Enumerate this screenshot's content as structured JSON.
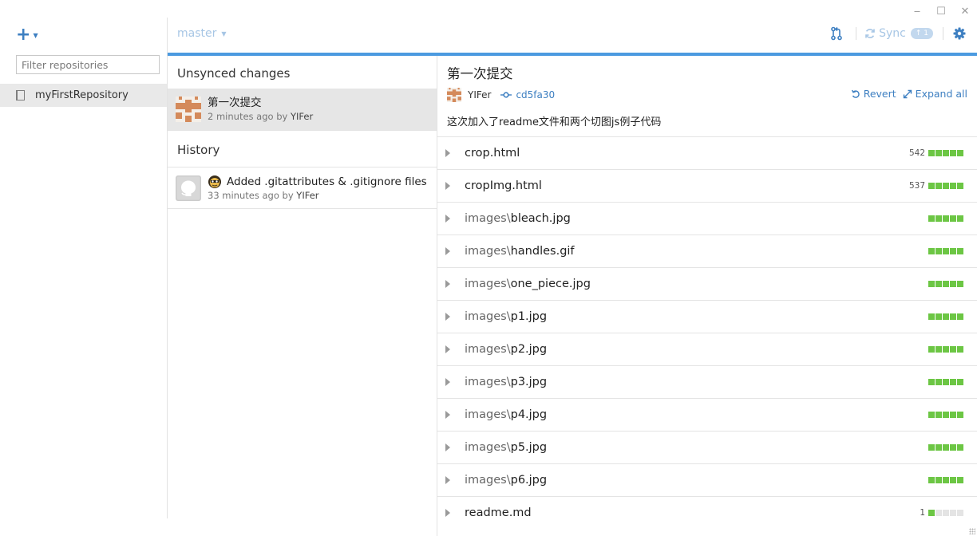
{
  "window": {
    "minimize_glyph": "‒",
    "maximize_glyph": "☐",
    "close_glyph": "✕"
  },
  "sidebar": {
    "add_glyph": "+",
    "filter_placeholder": "Filter repositories",
    "repos": [
      {
        "label": "myFirstRepository",
        "icon": "book-icon"
      }
    ]
  },
  "toolbar": {
    "branch": "master",
    "sync_label": "Sync",
    "sync_badge": "↑ 1"
  },
  "middle": {
    "unsynced_title": "Unsynced changes",
    "unsynced": [
      {
        "message": "第一次提交",
        "time": "2 minutes ago by",
        "author": "YIFer"
      }
    ],
    "history_title": "History",
    "history": [
      {
        "message": "Added .gitattributes & .gitignore files",
        "time": "33 minutes ago by",
        "author": "YIFer"
      }
    ]
  },
  "commit": {
    "title": "第一次提交",
    "author": "YIFer",
    "sha": "cd5fa30",
    "revert_label": "Revert",
    "expand_label": "Expand all",
    "description": "这次加入了readme文件和两个切图js例子代码"
  },
  "files": [
    {
      "dir": "",
      "name": "crop.html",
      "count": "542",
      "added_blocks": 5
    },
    {
      "dir": "",
      "name": "cropImg.html",
      "count": "537",
      "added_blocks": 5
    },
    {
      "dir": "images\\",
      "name": "bleach.jpg",
      "count": "",
      "added_blocks": 5
    },
    {
      "dir": "images\\",
      "name": "handles.gif",
      "count": "",
      "added_blocks": 5
    },
    {
      "dir": "images\\",
      "name": "one_piece.jpg",
      "count": "",
      "added_blocks": 5
    },
    {
      "dir": "images\\",
      "name": "p1.jpg",
      "count": "",
      "added_blocks": 5
    },
    {
      "dir": "images\\",
      "name": "p2.jpg",
      "count": "",
      "added_blocks": 5
    },
    {
      "dir": "images\\",
      "name": "p3.jpg",
      "count": "",
      "added_blocks": 5
    },
    {
      "dir": "images\\",
      "name": "p4.jpg",
      "count": "",
      "added_blocks": 5
    },
    {
      "dir": "images\\",
      "name": "p5.jpg",
      "count": "",
      "added_blocks": 5
    },
    {
      "dir": "images\\",
      "name": "p6.jpg",
      "count": "",
      "added_blocks": 5
    },
    {
      "dir": "",
      "name": "readme.md",
      "count": "1",
      "added_blocks": 1
    }
  ],
  "colors": {
    "accent": "#3d7fc1",
    "bar": "#4b9ae0",
    "added": "#6cc644"
  }
}
